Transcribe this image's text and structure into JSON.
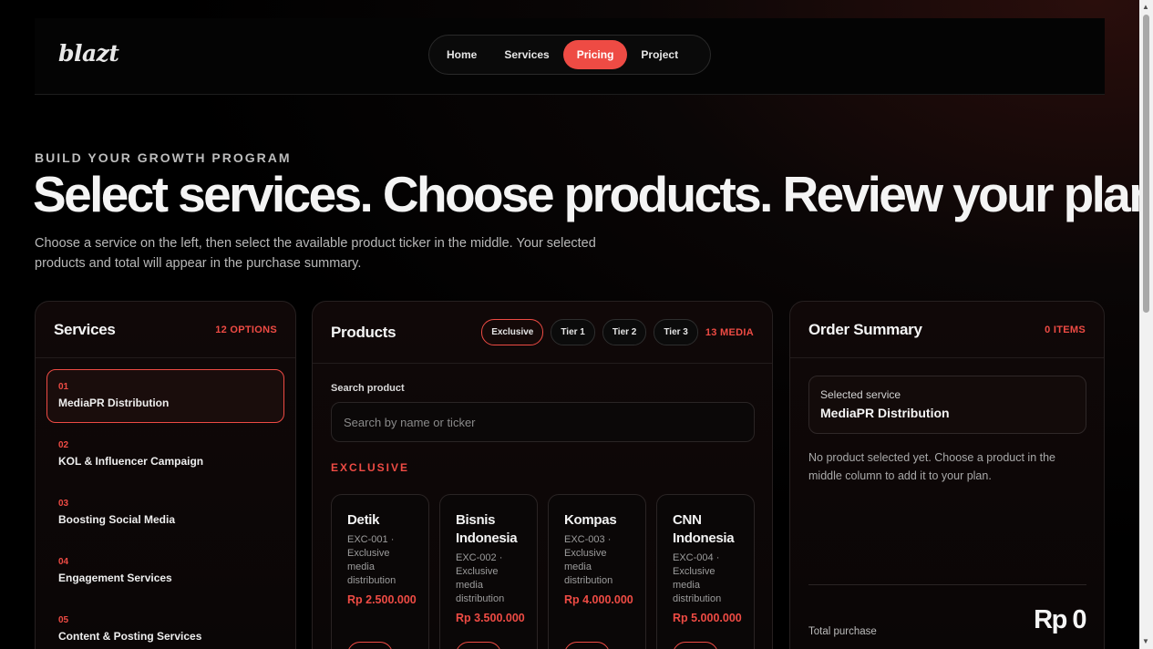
{
  "brand": {
    "logo": "blazt"
  },
  "nav": {
    "items": [
      "Home",
      "Services",
      "Pricing",
      "Project"
    ],
    "active": "Pricing"
  },
  "hero": {
    "eyebrow": "BUILD YOUR GROWTH PROGRAM",
    "headline": "Select services. Choose products. Review your plan.",
    "intro": "Choose a service on the left, then select the available product ticker in the middle. Your selected products and total will appear in the purchase summary."
  },
  "services": {
    "title": "Services",
    "count": "12 OPTIONS",
    "items": [
      {
        "num": "01",
        "name": "MediaPR Distribution",
        "active": true
      },
      {
        "num": "02",
        "name": "KOL & Influencer Campaign"
      },
      {
        "num": "03",
        "name": "Boosting Social Media"
      },
      {
        "num": "04",
        "name": "Engagement Services"
      },
      {
        "num": "05",
        "name": "Content & Posting Services"
      }
    ]
  },
  "products": {
    "title": "Products",
    "tiers": [
      "Exclusive",
      "Tier 1",
      "Tier 2",
      "Tier 3"
    ],
    "active_tier": "Exclusive",
    "count": "13 MEDIA",
    "search_label": "Search product",
    "search_placeholder": "Search by name or ticker",
    "section": "EXCLUSIVE",
    "cards": [
      {
        "name": "Detik",
        "desc": "EXC-001 · Exclusive media distribution",
        "price": "Rp 2.500.000"
      },
      {
        "name": "Bisnis Indonesia",
        "desc": "EXC-002 · Exclusive media distribution",
        "price": "Rp 3.500.000"
      },
      {
        "name": "Kompas",
        "desc": "EXC-003 · Exclusive media distribution",
        "price": "Rp 4.000.000"
      },
      {
        "name": "CNN Indonesia",
        "desc": "EXC-004 · Exclusive media distribution",
        "price": "Rp 5.000.000"
      }
    ]
  },
  "summary": {
    "title": "Order Summary",
    "count": "0 ITEMS",
    "selected_label": "Selected service",
    "selected_value": "MediaPR Distribution",
    "empty_note": "No product selected yet. Choose a product in the middle column to add it to your plan.",
    "total_label": "Total purchase",
    "total_value": "Rp 0"
  },
  "colors": {
    "accent": "#ee4b44",
    "background": "#000000"
  }
}
